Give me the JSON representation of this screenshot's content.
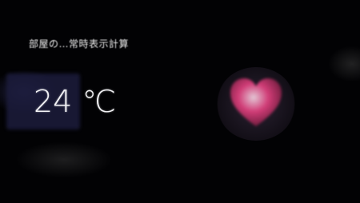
{
  "location_label": "部屋の…常時表示計算",
  "weather": {
    "temperature": "24 ℃",
    "condition": "",
    "secondary": ""
  },
  "colors": {
    "background": "#000000",
    "accent_heart": "#e0407e",
    "weather_panel": "#1c1c3c"
  },
  "icons": {
    "heart": "heart-icon"
  }
}
